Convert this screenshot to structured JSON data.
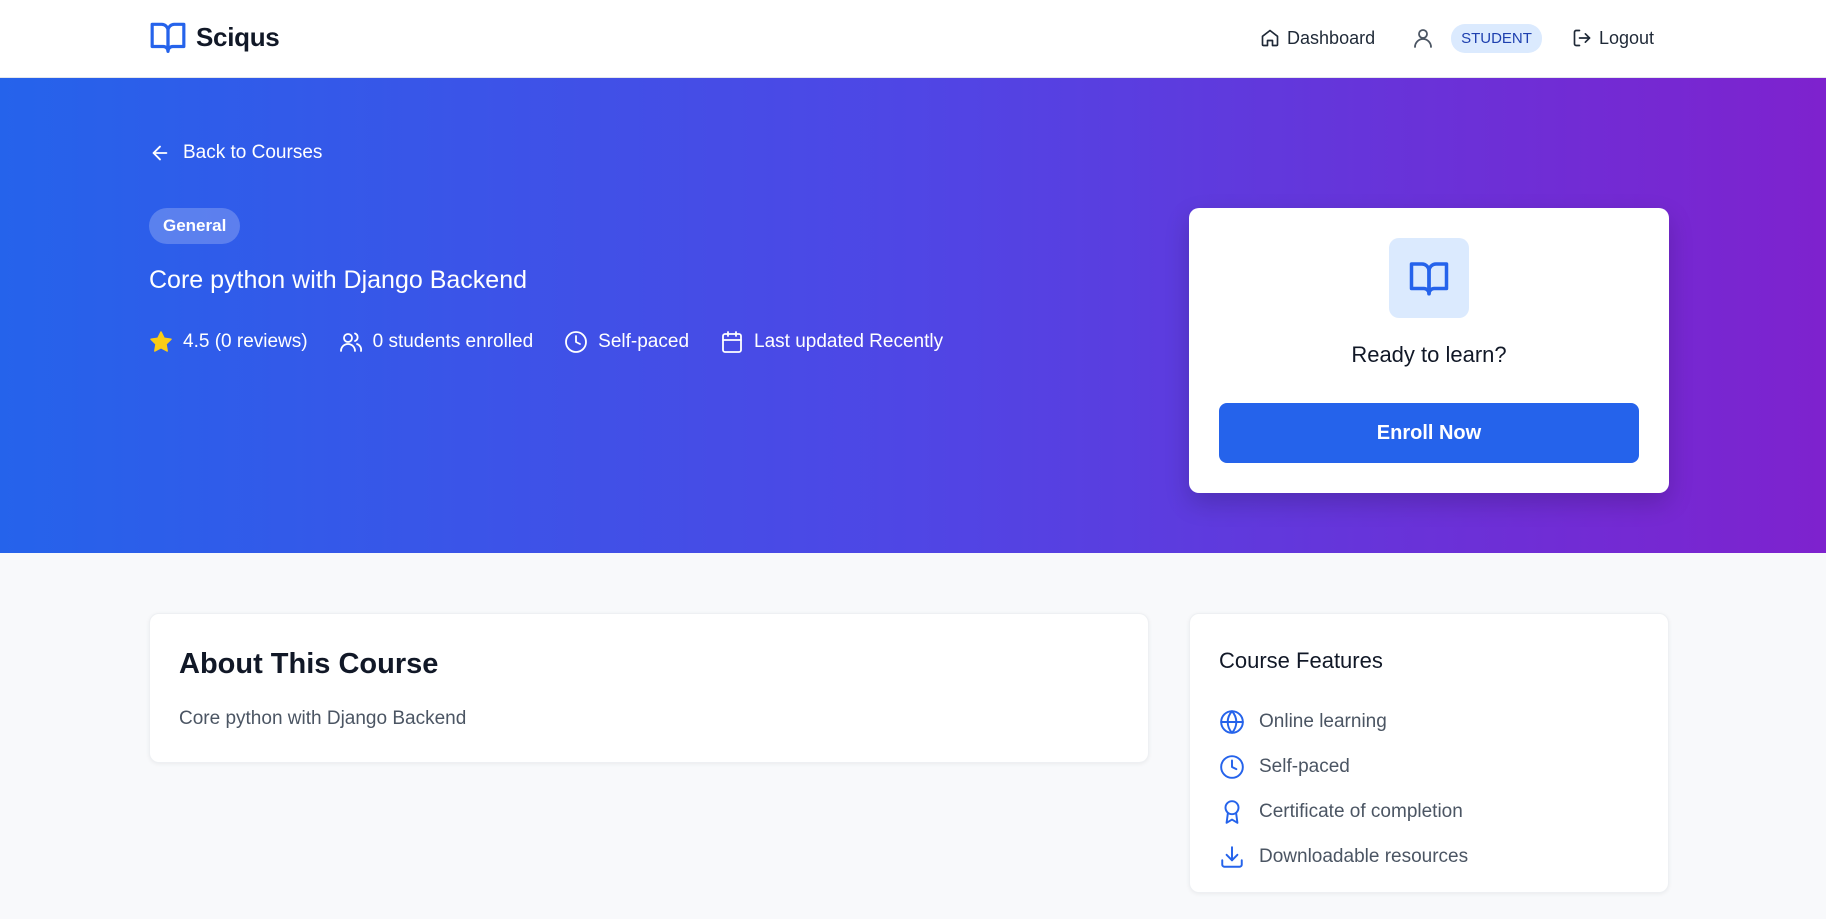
{
  "app": {
    "name": "Sciqus"
  },
  "nav": {
    "dashboard": "Dashboard",
    "role": "STUDENT",
    "logout": "Logout"
  },
  "hero": {
    "back": "Back to Courses",
    "category": "General",
    "title": "Core python with Django Backend",
    "rating": "4.5 (0 reviews)",
    "students": "0 students enrolled",
    "pace": "Self-paced",
    "updated": "Last updated Recently"
  },
  "enroll": {
    "prompt": "Ready to learn?",
    "button": "Enroll Now"
  },
  "about": {
    "title": "About This Course",
    "description": "Core python with Django Backend"
  },
  "features": {
    "title": "Course Features",
    "items": [
      {
        "label": "Online learning",
        "icon": "globe-icon"
      },
      {
        "label": "Self-paced",
        "icon": "clock-icon"
      },
      {
        "label": "Certificate of completion",
        "icon": "award-icon"
      },
      {
        "label": "Downloadable resources",
        "icon": "download-icon"
      }
    ]
  },
  "colors": {
    "primary": "#2563eb",
    "gradient_start": "#2563eb",
    "gradient_end": "#7e22ce",
    "star": "#facc15"
  }
}
